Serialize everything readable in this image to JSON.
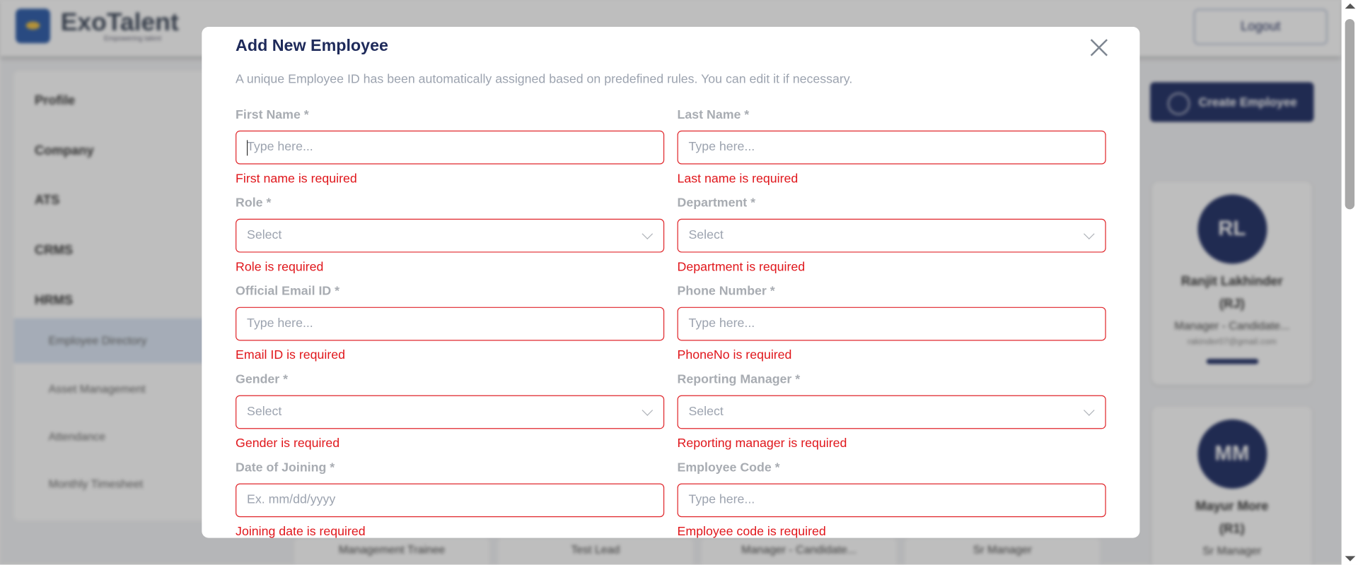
{
  "background": {
    "brand": "ExoTalent",
    "brand_sub": "Empowering talent",
    "logout": "Logout",
    "sidebar": [
      "Profile",
      "Company",
      "ATS",
      "CRMS",
      "HRMS"
    ],
    "sidebar_sub": [
      "Employee Directory",
      "Asset Management",
      "Attendance",
      "Monthly Timesheet"
    ],
    "create_button": "Create Employee",
    "cards": [
      {
        "initials": "RL",
        "name": "Ranjit Lakhinder",
        "code": "(RJ)",
        "role": "Manager - Candidate...",
        "email": "rakinder07@gmail.com"
      },
      {
        "initials": "MM",
        "name": "Mayur More",
        "code": "(R1)",
        "role": "Sr Manager"
      }
    ],
    "bottom_roles": [
      "Management Trainee",
      "Test Lead",
      "Manager - Candidate...",
      "Sr Manager"
    ]
  },
  "modal": {
    "title": "Add New Employee",
    "subtitle": "A unique Employee ID has been automatically assigned based on predefined rules. You can edit it if necessary.",
    "fields": [
      {
        "label": "First Name *",
        "placeholder": "Type here...",
        "error": "First name is required"
      },
      {
        "label": "Last Name *",
        "placeholder": "Type here...",
        "error": "Last name is required"
      },
      {
        "label": "Role *",
        "placeholder": "Select",
        "error": "Role is required"
      },
      {
        "label": "Department *",
        "placeholder": "Select",
        "error": "Department is required"
      },
      {
        "label": "Official Email ID *",
        "placeholder": "Type here...",
        "error": "Email ID is required"
      },
      {
        "label": "Phone Number *",
        "placeholder": "Type here...",
        "error": "PhoneNo is required"
      },
      {
        "label": "Gender *",
        "placeholder": "Select",
        "error": "Gender is required"
      },
      {
        "label": "Reporting Manager *",
        "placeholder": "Select",
        "error": "Reporting manager is required"
      },
      {
        "label": "Date of Joining *",
        "placeholder": "Ex. mm/dd/yyyy",
        "error": "Joining date is required"
      },
      {
        "label": "Employee Code *",
        "placeholder": "Type here...",
        "error": "Employee code is required"
      }
    ]
  }
}
